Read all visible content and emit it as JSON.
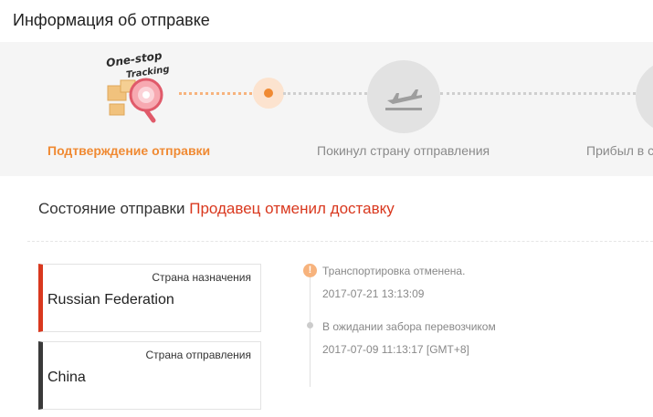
{
  "header": {
    "title": "Информация об отправке"
  },
  "tracker": {
    "logo": {
      "line1": "One-stop",
      "line2": "Tracking"
    },
    "steps": [
      {
        "label": "Подтверждение отправки",
        "state": "active"
      },
      {
        "label": "Покинул страну отправления",
        "state": "pending",
        "icon": "airplane-departure-icon"
      },
      {
        "label": "Прибыл в с",
        "state": "pending"
      }
    ],
    "colors": {
      "active": "#f08a33",
      "pending": "#8a8a8a"
    }
  },
  "status": {
    "label": "Состояние отправки",
    "value": "Продавец отменил доставку",
    "value_color": "#d9381e"
  },
  "destination": {
    "caption": "Страна назначения",
    "country": "Russian Federation"
  },
  "origin": {
    "caption": "Страна отправления",
    "country": "China"
  },
  "timeline": [
    {
      "event": "Транспортировка отменена.",
      "time": "2017-07-21 13:13:09",
      "icon": "alert-icon"
    },
    {
      "event": "В ожидании забора перевозчиком",
      "time": "2017-07-09 11:13:17 [GMT+8]",
      "icon": "dot-icon"
    }
  ]
}
